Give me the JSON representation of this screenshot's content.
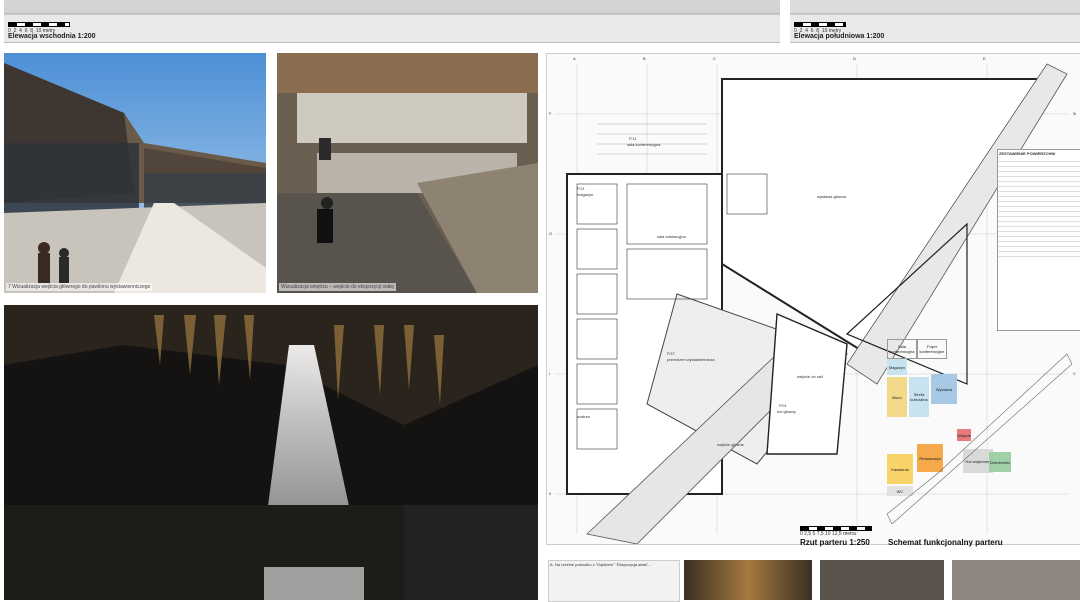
{
  "elevations": {
    "east": {
      "caption": "Elewacja wschodnia",
      "scale": "1:200",
      "scale_ticks": [
        "0",
        "2",
        "4",
        "6",
        "8",
        "10 metry"
      ]
    },
    "south": {
      "caption": "Elewacja południowa",
      "scale": "1:200",
      "scale_ticks": [
        "0",
        "2",
        "4",
        "6",
        "8",
        "10 metry"
      ]
    }
  },
  "photos": {
    "entrance": {
      "caption": "7 Wizualizacja wejścia głównego do pawilonu wystawienniczego"
    },
    "ramp": {
      "caption": "Wizualizacja wnętrza – wejście do ekspozycji stałej"
    }
  },
  "plan": {
    "title": "Rzut parteru",
    "scale": "1:250",
    "scale_ticks": [
      "0",
      "2,5",
      "5",
      "7,5",
      "10",
      "12,5 metra"
    ],
    "grid_letters": [
      "A",
      "B",
      "C",
      "D",
      "E",
      "F",
      "G"
    ],
    "grid_numbers": [
      "I",
      "II",
      "III",
      "IV",
      "V"
    ],
    "rooms": [
      {
        "id": "P.01",
        "name": "hol główny"
      },
      {
        "id": "P.11",
        "name": "sala konferencyjna"
      },
      {
        "id": "P.21",
        "name": "magazyn"
      },
      {
        "id": "P.37",
        "name": "przestrzeń wystawiennicza"
      },
      {
        "id": "",
        "name": "wystawa główna"
      },
      {
        "id": "",
        "name": "wejście do sali"
      },
      {
        "id": "",
        "name": "szatnia"
      },
      {
        "id": "",
        "name": "sala edukacyjna"
      },
      {
        "id": "",
        "name": "wejście główne"
      }
    ]
  },
  "legend": {
    "title": "ZESTAWIENIE POWIERZCHNI"
  },
  "schema": {
    "title": "Schemat funkcjonalny parteru",
    "zones": [
      {
        "label": "Sala konferencyjna",
        "color": "#ffffff"
      },
      {
        "label": "Foyer konferencyjne",
        "color": "#ffffff"
      },
      {
        "label": "Magazyn",
        "color": "#c7e3f0"
      },
      {
        "label": "Biuro",
        "color": "#f2d98a"
      },
      {
        "label": "Strefa kulturalna",
        "color": "#c7e3f0"
      },
      {
        "label": "Wystawa",
        "color": "#a8c9e6"
      },
      {
        "label": "Restauracja",
        "color": "#f5a94a"
      },
      {
        "label": "Kawiarnia",
        "color": "#f7d36a"
      },
      {
        "label": "WC",
        "color": "#e2e2e2"
      },
      {
        "label": "Hol wejściowy",
        "color": "#d9d9d9"
      },
      {
        "label": "Wejście",
        "color": "#e87b7b"
      },
      {
        "label": "Dziedziniec",
        "color": "#9fd1a7"
      }
    ]
  },
  "thumbs": {
    "first_caption": "A. Na rzeźbie pośrodku z \"Dąbkiem\" \"Ekspozycja stała\"..."
  }
}
